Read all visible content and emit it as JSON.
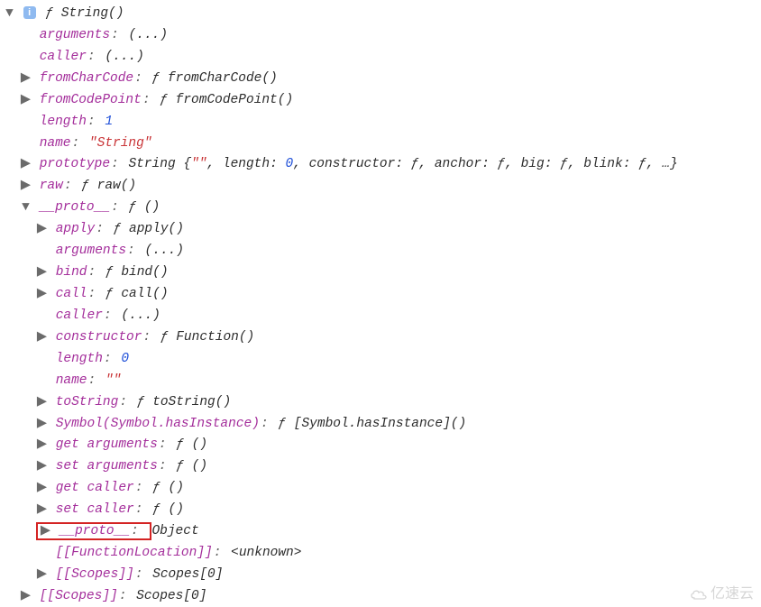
{
  "icons": {
    "down": "▼",
    "right": "▶"
  },
  "root": {
    "fn_sig": "ƒ String()"
  },
  "lvl1": {
    "arguments": {
      "key": "arguments",
      "val": "(...)"
    },
    "caller": {
      "key": "caller",
      "val": "(...)"
    },
    "fromCharCode": {
      "key": "fromCharCode",
      "val": "ƒ fromCharCode()"
    },
    "fromCodePoint": {
      "key": "fromCodePoint",
      "val": "ƒ fromCodePoint()"
    },
    "length": {
      "key": "length",
      "val": "1"
    },
    "name": {
      "key": "name",
      "quote": "\"",
      "val": "String"
    },
    "prototype": {
      "key": "prototype",
      "label": "String ",
      "open": "{",
      "close": "}",
      "parts": [
        {
          "t": "s",
          "v": "\"\""
        },
        {
          "t": "sep",
          "v": ", "
        },
        {
          "t": "key",
          "v": "length"
        },
        {
          "t": "colon",
          "v": ": "
        },
        {
          "t": "n",
          "v": "0"
        },
        {
          "t": "sep",
          "v": ", "
        },
        {
          "t": "key",
          "v": "constructor"
        },
        {
          "t": "colon",
          "v": ": "
        },
        {
          "t": "f",
          "v": "ƒ"
        },
        {
          "t": "sep",
          "v": ", "
        },
        {
          "t": "key",
          "v": "anchor"
        },
        {
          "t": "colon",
          "v": ": "
        },
        {
          "t": "f",
          "v": "ƒ"
        },
        {
          "t": "sep",
          "v": ", "
        },
        {
          "t": "key",
          "v": "big"
        },
        {
          "t": "colon",
          "v": ": "
        },
        {
          "t": "f",
          "v": "ƒ"
        },
        {
          "t": "sep",
          "v": ", "
        },
        {
          "t": "key",
          "v": "blink"
        },
        {
          "t": "colon",
          "v": ": "
        },
        {
          "t": "f",
          "v": "ƒ"
        },
        {
          "t": "sep",
          "v": ", …"
        }
      ]
    },
    "raw": {
      "key": "raw",
      "val": "ƒ raw()"
    },
    "proto": {
      "key": "__proto__",
      "val": "ƒ ()"
    }
  },
  "proto_children": {
    "apply": {
      "key": "apply",
      "val": "ƒ apply()"
    },
    "arguments": {
      "key": "arguments",
      "val": "(...)"
    },
    "bind": {
      "key": "bind",
      "val": "ƒ bind()"
    },
    "call": {
      "key": "call",
      "val": "ƒ call()"
    },
    "caller": {
      "key": "caller",
      "val": "(...)"
    },
    "constructor": {
      "key": "constructor",
      "val": "ƒ Function()"
    },
    "length": {
      "key": "length",
      "val": "0"
    },
    "name": {
      "key": "name",
      "val": "\"\""
    },
    "toString": {
      "key": "toString",
      "val": "ƒ toString()"
    },
    "symbolHasInstance": {
      "key": "Symbol(Symbol.hasInstance)",
      "val": "ƒ [Symbol.hasInstance]()"
    },
    "getArguments": {
      "key": "get arguments",
      "val": "ƒ ()"
    },
    "setArguments": {
      "key": "set arguments",
      "val": "ƒ ()"
    },
    "getCaller": {
      "key": "get caller",
      "val": "ƒ ()"
    },
    "setCaller": {
      "key": "set caller",
      "val": "ƒ ()"
    },
    "protoProto": {
      "key": "__proto__",
      "val": "Object"
    },
    "functionLocation": {
      "key": "[[FunctionLocation]]",
      "val": "<unknown>"
    },
    "scopes": {
      "key": "[[Scopes]]",
      "val": "Scopes[0]"
    }
  },
  "lvl1_tail": {
    "scopes": {
      "key": "[[Scopes]]",
      "val": "Scopes[0]"
    }
  },
  "watermark": "亿速云"
}
